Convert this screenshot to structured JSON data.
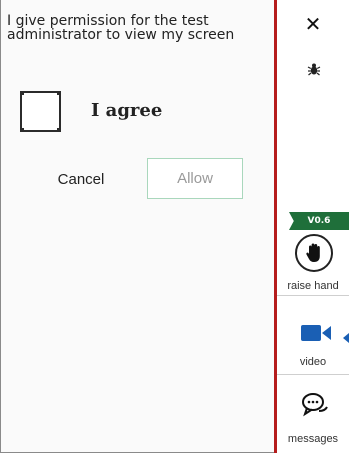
{
  "permission": {
    "text": "I give permission for the test administrator to view my screen",
    "agree_label": "I agree",
    "cancel_label": "Cancel",
    "allow_label": "Allow",
    "checked": false
  },
  "sidebar": {
    "close_symbol": "✕",
    "version": "V0.6",
    "raise_hand_label": "raise hand",
    "video_label": "video",
    "messages_label": "messages"
  },
  "colors": {
    "divider": "#b51c1c",
    "badge": "#1f6f3a",
    "video_icon": "#1a5fb4",
    "allow_border": "#a9d7bc"
  },
  "icons": [
    "close-icon",
    "bug-icon",
    "raise-hand-icon",
    "video-camera-icon",
    "chat-bubbles-icon"
  ]
}
